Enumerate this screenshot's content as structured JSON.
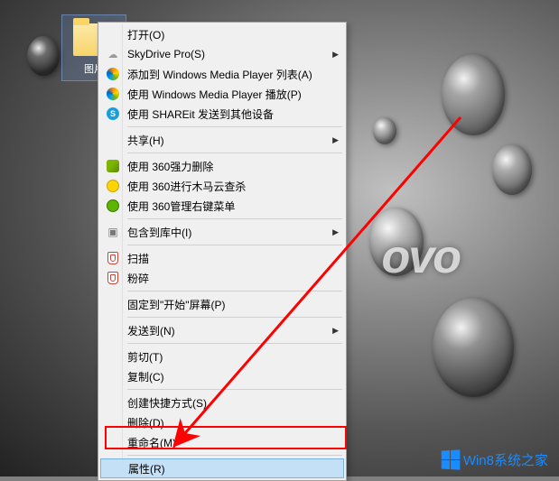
{
  "folder": {
    "label": "图片"
  },
  "menu": {
    "open": "打开(O)",
    "skydrive": "SkyDrive Pro(S)",
    "wmp_add": "添加到 Windows Media Player 列表(A)",
    "wmp_play": "使用 Windows Media Player 播放(P)",
    "shareit": "使用 SHAREit 发送到其他设备",
    "share": "共享(H)",
    "del360": "使用 360强力删除",
    "scan360": "使用 360进行木马云查杀",
    "mgr360": "使用 360管理右键菜单",
    "include_lib": "包含到库中(I)",
    "shield_scan": "扫描",
    "shield_shred": "粉碎",
    "pin_start": "固定到\"开始\"屏幕(P)",
    "send_to": "发送到(N)",
    "cut": "剪切(T)",
    "copy": "复制(C)",
    "shortcut": "创建快捷方式(S)",
    "delete": "删除(D)",
    "rename": "重命名(M)",
    "properties": "属性(R)"
  },
  "branding": {
    "lenovo": "ovo",
    "win8": "Win8系统之家"
  }
}
